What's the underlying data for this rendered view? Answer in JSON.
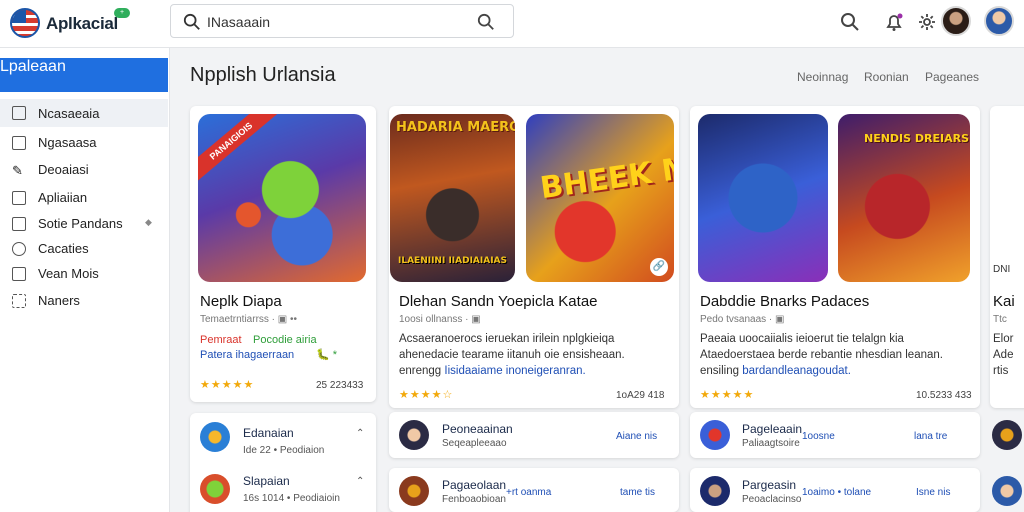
{
  "header": {
    "app_name": "Aplkacial",
    "app_badge": "+",
    "search_value": "INasaaain"
  },
  "sidebar": {
    "items": [
      {
        "label": "Lpaleaan"
      },
      {
        "label": "Ncasaeaia"
      },
      {
        "label": "Ngasaasa"
      },
      {
        "label": "Deoaiasi"
      },
      {
        "label": "Apliaiian"
      },
      {
        "label": "Sotie Pandans"
      },
      {
        "label": "Cacaties"
      },
      {
        "label": "Vean Mois"
      },
      {
        "label": "Naners"
      }
    ]
  },
  "main": {
    "title": "Npplish Urlansia",
    "top_links": [
      "Neoinnag",
      "Roonian",
      "Pageanes"
    ],
    "cards": [
      {
        "title": "Neplk Diapa",
        "meta": "Temaetrntiarrss · ▣ ••",
        "tagline_red": "Pemraat",
        "tagline_green": "Pocodie airia",
        "tagline_blue": "Patera ihagaerraan",
        "tagline_extra": "🐛 *",
        "stars": "★★★★★",
        "count": "25 223433",
        "ribbon": "PANAIGIOIS"
      },
      {
        "title": "Dlehan Sandn Yoepicla Katae",
        "meta": "1oosi ollnanss · ▣",
        "desc_1": "Acsaeranoerocs ieruekan irilein nplgkieiqa",
        "desc_2": "ahenedacie tearame iitanuh oie ensisheaan.",
        "desc_3_plain": "enrengg",
        "desc_3_hl": "Iisidaaiame inoneigeranran.",
        "stars": "★★★★☆",
        "count": "1oA29 418",
        "art_top": "HADARIA MAEROS",
        "art_bottom": "ILAENIINI IIADIAIAIAS",
        "art_big": "BHEEK MINGI"
      },
      {
        "title": "Dabddie Bnarks Padaces",
        "meta": "Pedo tvsanaas · ▣",
        "desc_1": "Paeaia uoocaiialis ieioerut tie telalgn kia",
        "desc_2": "Ataedoerstaea berde rebantie nhesdian leanan.",
        "desc_3_plain": "ensiling",
        "desc_3_hl": "bardandleanagoudat.",
        "stars": "★★★★★",
        "count": "10.5233 433",
        "art_top": "NENDIS DREIARS"
      }
    ],
    "side_lists": [
      {
        "items": [
          {
            "name": "Edanaian",
            "sub": "",
            "right": "⌃"
          },
          {
            "name": "Slapaian",
            "sub": "16s 1014 • Peodiaioin",
            "right": "⌃"
          }
        ],
        "first_sub": "Ide 22 • Peodiaion"
      },
      {
        "items": [
          {
            "name": "Peoneaainan",
            "sub": "Seqeapleeaao",
            "right": "Aiane nis"
          },
          {
            "name": "Pagaeolaan",
            "sub": "Fenboaobioan",
            "right": "tame tis",
            "mid": "+rt oanma"
          }
        ]
      },
      {
        "items": [
          {
            "name": "Pageleaain",
            "sub": "Paliaagtsoire",
            "right": "lana tre",
            "mid": "1oosne"
          },
          {
            "name": "Pargeasin",
            "sub": "Peoaclacinso",
            "right": "Isne nis",
            "mid": "1oaimo • tolane"
          }
        ]
      }
    ],
    "edge_card": {
      "label": "DNI",
      "title": "Kai",
      "lines": [
        "Ttc",
        "Elor",
        "Ade",
        "rtis"
      ]
    }
  },
  "colors": {
    "accent": "#1f6fe0",
    "star": "#f2a90b",
    "link_blue": "#1f4fb5",
    "red": "#d9332b",
    "green": "#2f9e3a"
  }
}
